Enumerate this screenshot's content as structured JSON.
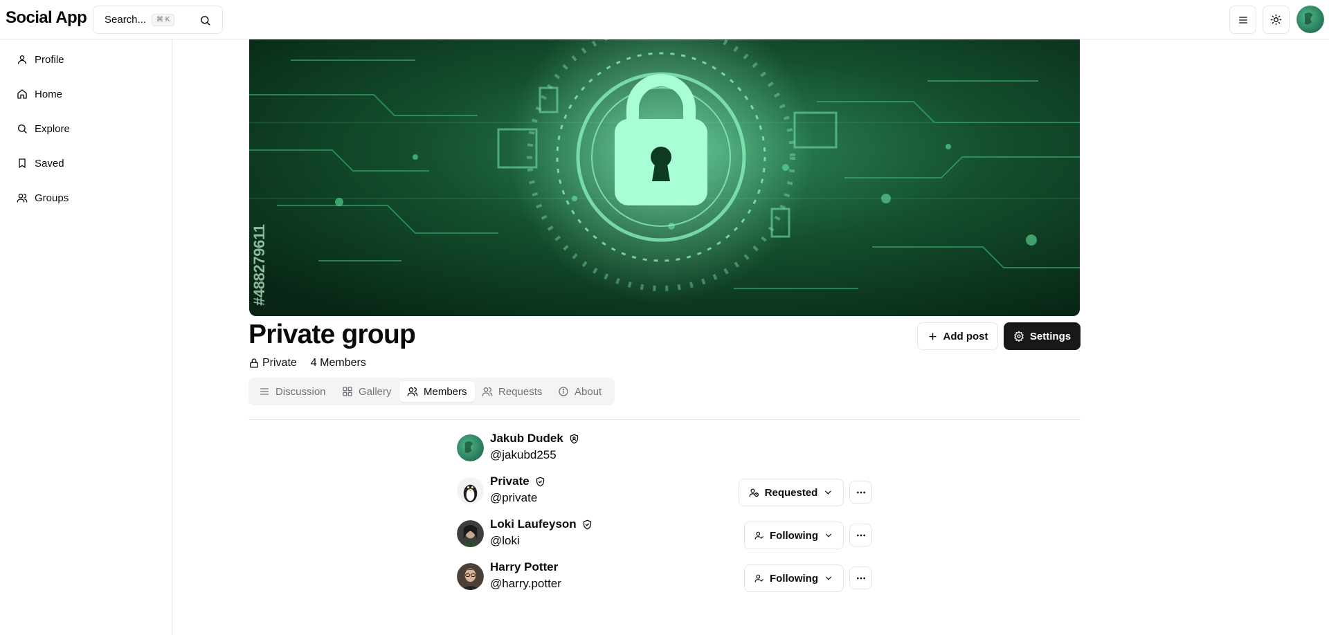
{
  "header": {
    "brand": "Social App",
    "search": {
      "placeholder": "Search...",
      "shortcut": "⌘ K"
    }
  },
  "sidebar": {
    "items": [
      {
        "label": "Profile",
        "icon": "user-icon"
      },
      {
        "label": "Home",
        "icon": "home-icon"
      },
      {
        "label": "Explore",
        "icon": "search-icon"
      },
      {
        "label": "Saved",
        "icon": "bookmark-icon"
      },
      {
        "label": "Groups",
        "icon": "users-icon"
      }
    ]
  },
  "group": {
    "title": "Private group",
    "privacy": "Private",
    "members_count": "4 Members",
    "banner_caption": "#488279611",
    "actions": {
      "add_post": "Add post",
      "settings": "Settings"
    }
  },
  "tabs": [
    {
      "label": "Discussion",
      "icon": "list-icon",
      "active": false
    },
    {
      "label": "Gallery",
      "icon": "grid-icon",
      "active": false
    },
    {
      "label": "Members",
      "icon": "users-icon",
      "active": true
    },
    {
      "label": "Requests",
      "icon": "users-icon",
      "active": false
    },
    {
      "label": "About",
      "icon": "info-icon",
      "active": false
    }
  ],
  "members": [
    {
      "name": "Jakub Dudek",
      "handle": "@jakubd255",
      "badge": "shield-user-icon",
      "status": ""
    },
    {
      "name": "Private",
      "handle": "@private",
      "badge": "shield-check-icon",
      "status": "Requested"
    },
    {
      "name": "Loki Laufeyson",
      "handle": "@loki",
      "badge": "shield-check-icon",
      "status": "Following"
    },
    {
      "name": "Harry Potter",
      "handle": "@harry.potter",
      "badge": "",
      "status": "Following"
    }
  ],
  "colors": {
    "primary_dark": "#18181b",
    "border": "#e5e5e5",
    "muted_text": "#71717a",
    "banner_green": "#0f3a22"
  }
}
